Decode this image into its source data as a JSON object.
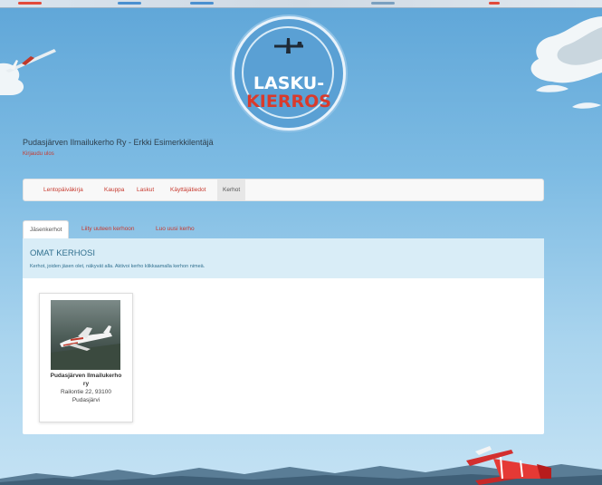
{
  "logo": {
    "line1": "LASKU-",
    "line2": "KIERROS"
  },
  "header": {
    "site_name": "Pudasjärven Ilmailukerho Ry - Erkki Esimerkkilentäjä",
    "logout": "Kirjaudu ulos"
  },
  "nav": {
    "items": [
      {
        "label": "Lentopäiväkirja"
      },
      {
        "label": "Kauppa"
      },
      {
        "label": "Laskut"
      },
      {
        "label": "Käyttäjätiedot"
      },
      {
        "label": "Kerhot"
      }
    ],
    "active": "Kerhot"
  },
  "tabs": {
    "items": [
      {
        "label": "Jäsenkerhot"
      },
      {
        "label": "Liity uuteen kerhoon"
      },
      {
        "label": "Luo uusi kerho"
      }
    ],
    "active": "Jäsenkerhot"
  },
  "panel": {
    "title": "OMAT KERHOSI",
    "description": "Kerhot, joiden jäsen olet, näkyvät alla. Aktivoi kerho klikkaamalla kerhon nimeä."
  },
  "clubs": [
    {
      "name_line1": "Pudasjärven Ilmailukerho",
      "name_line2": "ry",
      "address_line1": "Railontie 22, 93100",
      "address_line2": "Pudasjärvi"
    }
  ],
  "colors": {
    "accent": "#c73a2f",
    "info_bg": "#d9edf7",
    "info_text": "#31708f",
    "sky": "#6aaedd"
  }
}
